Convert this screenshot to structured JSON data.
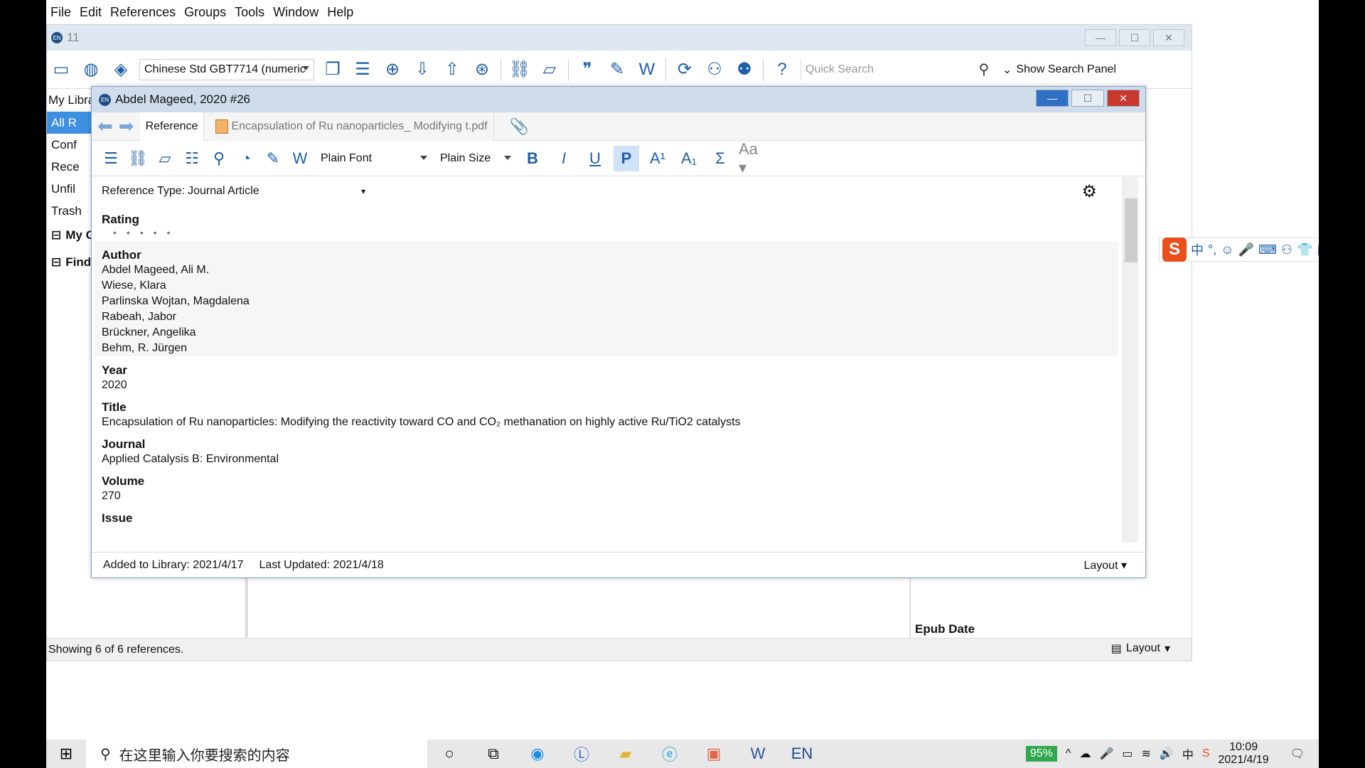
{
  "menu": [
    "File",
    "Edit",
    "References",
    "Groups",
    "Tools",
    "Window",
    "Help"
  ],
  "app": {
    "title": "11",
    "style": "Chinese Std GBT7714 (numeric",
    "quick_search_placeholder": "Quick Search",
    "show_search_panel": "Show Search Panel"
  },
  "left": {
    "header": "My Libra",
    "items": [
      "All R",
      "Conf",
      "Rece",
      "Unfil",
      "Trash"
    ],
    "groups": [
      "My G",
      "Find"
    ]
  },
  "right": {
    "epub_label": "Epub Date"
  },
  "status": {
    "text": "Showing 6 of 6 references.",
    "layout": "Layout"
  },
  "dialog": {
    "title": "Abdel Mageed, 2020 #26",
    "tab_reference": "Reference",
    "tab_pdf": "Encapsulation of Ru nanoparticles_ Modifying t.pdf",
    "font": "Plain Font",
    "size": "Plain Size",
    "reference_type_label": "Reference Type:",
    "reference_type": "Journal Article",
    "fields": {
      "rating_label": "Rating",
      "author_label": "Author",
      "authors": [
        "Abdel Mageed, Ali M.",
        "Wiese, Klara",
        "Parlinska Wojtan, Magdalena",
        "Rabeah, Jabor",
        "Brückner, Angelika",
        "Behm, R. Jürgen"
      ],
      "year_label": "Year",
      "year": "2020",
      "title_label": "Title",
      "title_text": "Encapsulation of Ru nanoparticles: Modifying the reactivity toward CO and CO₂ methanation on highly active Ru/TiO2 catalysts",
      "journal_label": "Journal",
      "journal": "Applied Catalysis B: Environmental",
      "volume_label": "Volume",
      "volume": "270",
      "issue_label": "Issue"
    },
    "added": "Added to Library: 2021/4/17",
    "updated": "Last Updated: 2021/4/18",
    "layout": "Layout"
  },
  "taskbar": {
    "search_placeholder": "在这里输入你要搜索的内容",
    "battery": "95%",
    "time": "10:09",
    "date": "2021/4/19"
  }
}
